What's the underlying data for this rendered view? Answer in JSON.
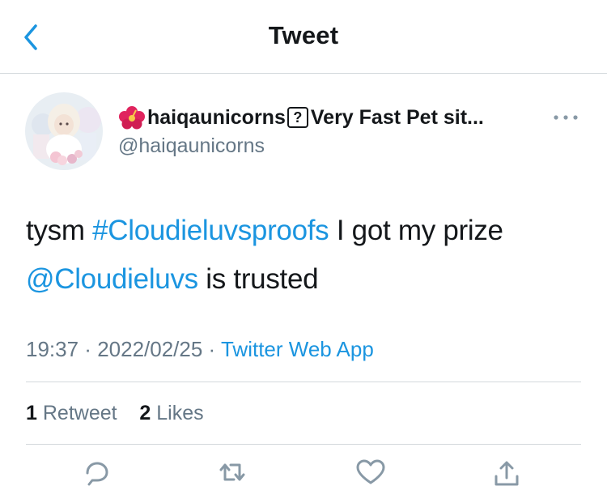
{
  "header": {
    "title": "Tweet"
  },
  "tweet": {
    "user": {
      "display_name": "haiqaunicorns",
      "display_name_suffix": "Very Fast Pet sit...",
      "handle": "@haiqaunicorns"
    },
    "text": {
      "part1": "tysm ",
      "hashtag": "#Cloudieluvsproofs",
      "part2": " I got my prize",
      "mention": "@Cloudieluvs",
      "part3": " is trusted"
    },
    "meta": {
      "time": "19:37",
      "date": "2022/02/25",
      "separator": " · ",
      "source": "Twitter Web App"
    },
    "stats": {
      "retweets_count": "1",
      "retweets_label": "Retweet",
      "likes_count": "2",
      "likes_label": "Likes"
    }
  },
  "icons": {
    "back": "chevron-left-icon",
    "more": "ellipsis-icon",
    "reply": "reply-icon",
    "retweet": "retweet-icon",
    "like": "heart-icon",
    "share": "share-icon"
  },
  "colors": {
    "link": "#1b95e0",
    "secondary_text": "#657786",
    "primary_text": "#14171a",
    "divider": "#d3d8dc"
  }
}
